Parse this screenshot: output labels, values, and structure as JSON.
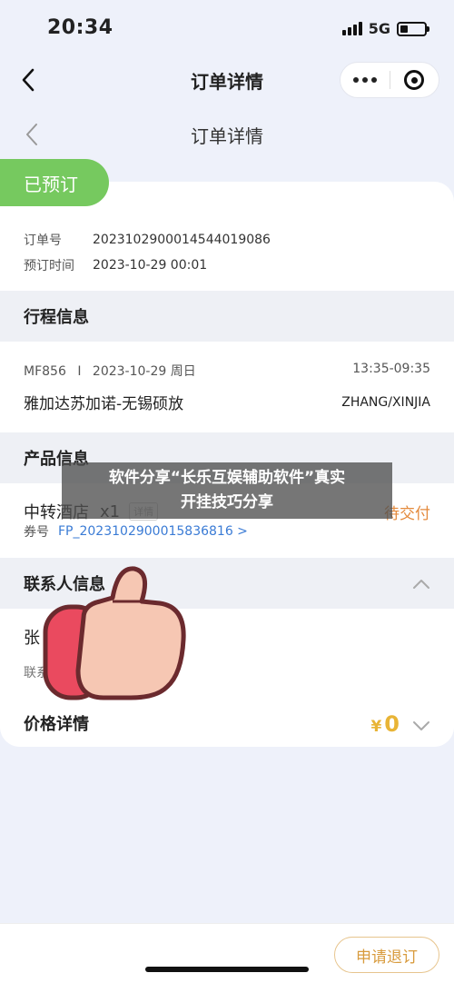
{
  "status_bar": {
    "time": "20:34",
    "network": "5G"
  },
  "nav": {
    "title": "订单详情"
  },
  "subheader": {
    "title": "订单详情"
  },
  "order": {
    "status_tag": "已预订",
    "number_label": "订单号",
    "number": "20231029000145440190​86",
    "time_label": "预订时间",
    "time": "2023-10-29 00:01"
  },
  "trip": {
    "header": "行程信息",
    "flight": "MF856",
    "separator": "I",
    "date": "2023-10-29 周日",
    "time_range": "13:35-09:35",
    "route": "雅加达苏加诺-无锡硕放",
    "passengers": "ZHANG/XINJIA"
  },
  "product": {
    "header": "产品信息",
    "name": "中转酒店",
    "qty": "x1",
    "tag": "详情",
    "status": "待交付",
    "voucher_label": "券号",
    "voucher_value": "FP_20231029000158368​16 >"
  },
  "contact": {
    "header": "联系人信息",
    "name": "张",
    "phone_label": "联系"
  },
  "price": {
    "header": "价格详情",
    "currency": "¥",
    "amount": "0"
  },
  "bottom": {
    "refund_button": "申请退订"
  },
  "overlay": {
    "line1": "软件分享“长乐互娱辅助软件”真实",
    "line2": "开挂技巧分享"
  },
  "colors": {
    "status_green": "#76c95f",
    "price_gold": "#e8b436",
    "link_blue": "#3a7bd5",
    "pending_orange": "#e48a3c"
  }
}
